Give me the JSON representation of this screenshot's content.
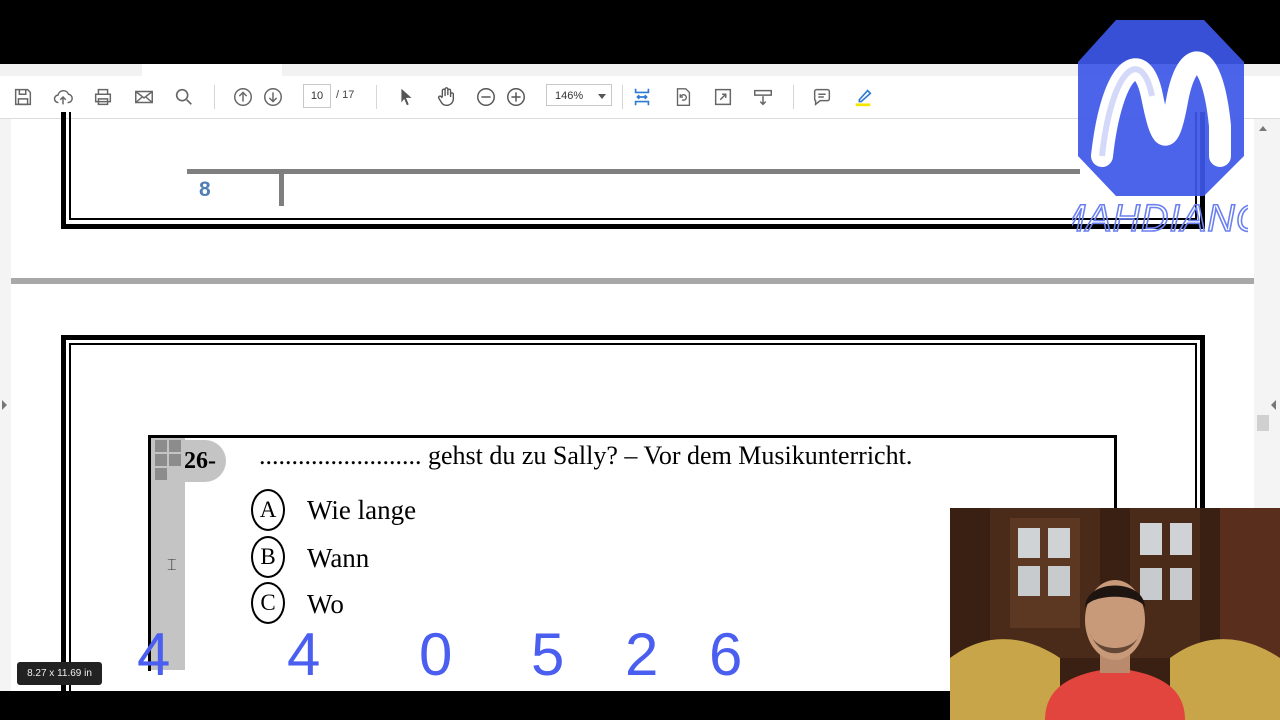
{
  "toolbar": {
    "page_current": "10",
    "page_total": "/ 17",
    "zoom": "146%",
    "icons": [
      "save-icon",
      "upload-icon",
      "print-icon",
      "email-icon",
      "search-icon",
      "prev-page-icon",
      "next-page-icon",
      "select-cursor-icon",
      "hand-tool-icon",
      "zoom-out-icon",
      "zoom-in-icon",
      "fit-page-icon",
      "rotate-icon",
      "full-screen-icon",
      "scroll-mode-icon",
      "comment-icon",
      "highlight-icon"
    ]
  },
  "page_top": {
    "page_number": "8"
  },
  "question": {
    "number": "26-",
    "prompt": "......................... gehst du zu Sally? – Vor dem Musikunterricht.",
    "options": [
      {
        "letter": "A",
        "text": "Wie lange"
      },
      {
        "letter": "B",
        "text": "Wann"
      },
      {
        "letter": "C",
        "text": "Wo"
      }
    ]
  },
  "overlay_code": [
    "4",
    "4",
    "0",
    "5",
    "2",
    "6"
  ],
  "page_size_badge": "8.27 x 11.69 in",
  "logo": {
    "text": "MAHDIANO",
    "color": "#3d57e8"
  },
  "colors": {
    "accent_blue": "#2f7ad1",
    "page_number_blue": "#4f7fb5",
    "code_blue": "#4a5ef0"
  }
}
